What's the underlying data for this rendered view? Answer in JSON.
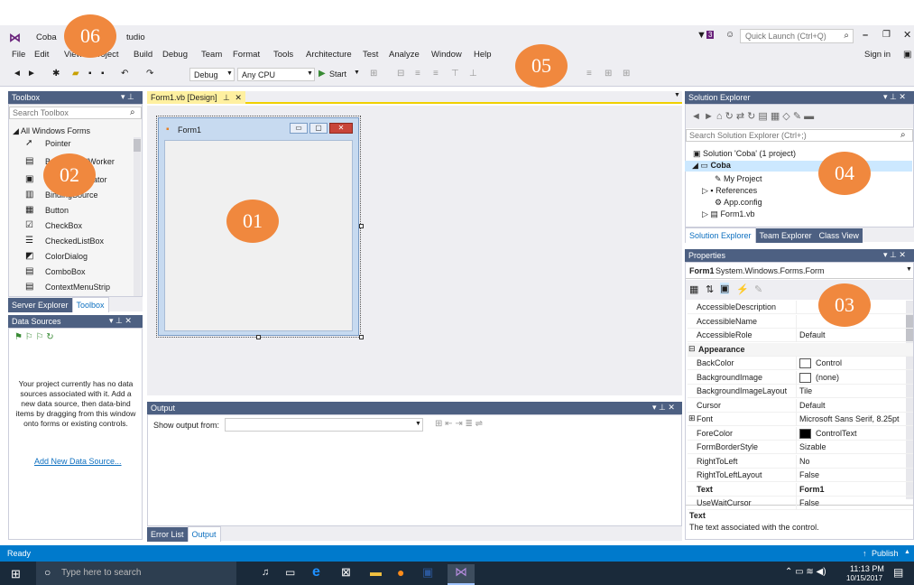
{
  "app": {
    "title_prefix": "Coba",
    "title_suffix": "tudio",
    "sign_in": "Sign in",
    "quick_launch_placeholder": "Quick Launch (Ctrl+Q)",
    "notification_count": "3"
  },
  "menu": [
    "File",
    "Edit",
    "View",
    "Project",
    "Build",
    "Debug",
    "Team",
    "Format",
    "Tools",
    "Architecture",
    "Test",
    "Analyze",
    "Window",
    "Help"
  ],
  "toolbar": {
    "config": "Debug",
    "platform": "Any CPU",
    "start": "Start"
  },
  "toolbox": {
    "title": "Toolbox",
    "search_placeholder": "Search Toolbox",
    "group": "All Windows Forms",
    "items": [
      "Pointer",
      "BackgroundWorker",
      "BindingNavigator",
      "BindingSource",
      "Button",
      "CheckBox",
      "CheckedListBox",
      "ColorDialog",
      "ComboBox",
      "ContextMenuStrip"
    ],
    "tabs": [
      "Server Explorer",
      "Toolbox"
    ]
  },
  "data_sources": {
    "title": "Data Sources",
    "message": "Your project currently has no data sources associated with it. Add a new data source, then data-bind items by dragging from this window onto forms or existing controls.",
    "link": "Add New Data Source..."
  },
  "designer": {
    "tab": "Form1.vb [Design]",
    "form_title": "Form1"
  },
  "output": {
    "title": "Output",
    "show_from": "Show output from:",
    "tabs": [
      "Error List",
      "Output"
    ]
  },
  "solution_explorer": {
    "title": "Solution Explorer",
    "search_placeholder": "Search Solution Explorer (Ctrl+;)",
    "items": [
      "Solution 'Coba' (1 project)",
      "Coba",
      "My Project",
      "References",
      "App.config",
      "Form1.vb"
    ],
    "tabs": [
      "Solution Explorer",
      "Team Explorer",
      "Class View"
    ]
  },
  "properties": {
    "title": "Properties",
    "object": "Form1",
    "object_type": "System.Windows.Forms.Form",
    "rows": [
      {
        "name": "AccessibleDescription",
        "value": ""
      },
      {
        "name": "AccessibleName",
        "value": ""
      },
      {
        "name": "AccessibleRole",
        "value": "Default"
      },
      {
        "name": "Appearance",
        "value": "",
        "category": true
      },
      {
        "name": "BackColor",
        "value": "Control",
        "swatch": "#ffffff"
      },
      {
        "name": "BackgroundImage",
        "value": "(none)",
        "swatch": "#ffffff"
      },
      {
        "name": "BackgroundImageLayout",
        "value": "Tile"
      },
      {
        "name": "Cursor",
        "value": "Default"
      },
      {
        "name": "Font",
        "value": "Microsoft Sans Serif, 8.25pt",
        "expand": true
      },
      {
        "name": "ForeColor",
        "value": "ControlText",
        "swatch": "#000000"
      },
      {
        "name": "FormBorderStyle",
        "value": "Sizable"
      },
      {
        "name": "RightToLeft",
        "value": "No"
      },
      {
        "name": "RightToLeftLayout",
        "value": "False"
      },
      {
        "name": "Text",
        "value": "Form1",
        "bold": true
      },
      {
        "name": "UseWaitCursor",
        "value": "False"
      }
    ],
    "desc_title": "Text",
    "desc_text": "The text associated with the control."
  },
  "status": {
    "left": "Ready",
    "right": "Publish"
  },
  "taskbar": {
    "search_placeholder": "Type here to search",
    "time": "11:13 PM",
    "date": "10/15/2017"
  },
  "badges": [
    "01",
    "02",
    "03",
    "04",
    "05",
    "06"
  ],
  "colors": {
    "accent": "#007acc",
    "badge": "#f0883e",
    "taskbar": "#1a2a3a"
  }
}
